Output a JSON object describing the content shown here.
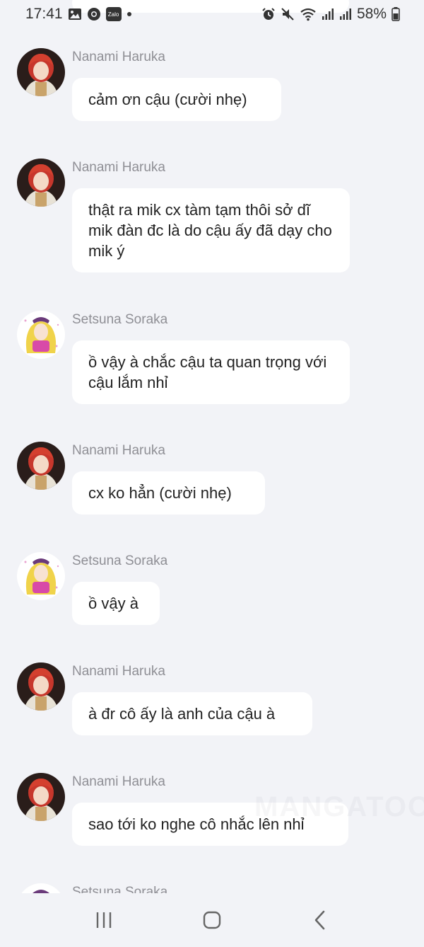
{
  "status_bar": {
    "time": "17:41",
    "left_icons": [
      "image-icon",
      "chrome-like-icon",
      "zalo-icon",
      "dot-icon"
    ],
    "zalo_label": "Zalo",
    "right_icons": [
      "alarm-icon",
      "mute-icon",
      "wifi-icon",
      "signal-icon",
      "signal-icon"
    ],
    "battery": "58%"
  },
  "chat": {
    "messages": [
      {
        "sender": "Nanami Haruka",
        "avatar": "nanami",
        "text": "cảm ơn cậu (cười nhẹ)"
      },
      {
        "sender": "Nanami Haruka",
        "avatar": "nanami",
        "text": "thật ra mik cx tàm tạm thôi sở dĩ mik đàn đc là do cậu ấy đã dạy cho mik ý"
      },
      {
        "sender": "Setsuna Soraka",
        "avatar": "setsuna",
        "text": "ồ vậy à chắc cậu ta quan trọng với cậu lắm nhỉ"
      },
      {
        "sender": "Nanami Haruka",
        "avatar": "nanami",
        "text": "cx ko hẳn (cười nhẹ)"
      },
      {
        "sender": "Setsuna Soraka",
        "avatar": "setsuna",
        "text": "ồ vậy à"
      },
      {
        "sender": "Nanami Haruka",
        "avatar": "nanami",
        "text": "à đr cô ấy là anh của cậu à"
      },
      {
        "sender": "Nanami Haruka",
        "avatar": "nanami",
        "text": "sao tới ko nghe cô nhắc lên nhỉ"
      },
      {
        "sender": "Setsuna Soraka",
        "avatar": "setsuna",
        "text": ""
      }
    ]
  },
  "watermark": "MANGATOON",
  "nav_bar": {
    "buttons": [
      "recent-apps",
      "home",
      "back"
    ]
  },
  "colors": {
    "background": "#f2f3f7",
    "bubble": "#ffffff",
    "sender": "#8f8f95",
    "text": "#222222"
  }
}
